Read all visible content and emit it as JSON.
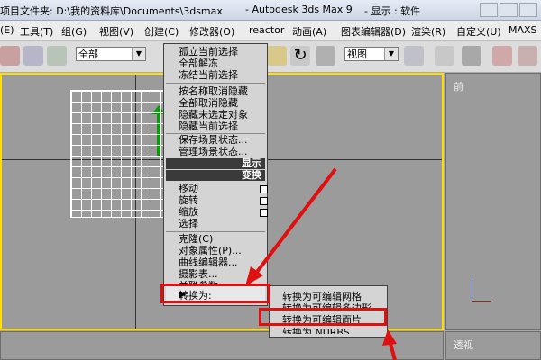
{
  "title": {
    "project": "项目文件夹: D:\\我的资料库\\Documents\\3dsmax",
    "app": "- Autodesk 3ds Max 9",
    "display": "- 显示 : 软件"
  },
  "menubar": {
    "items": [
      "(E)",
      "工具(T)",
      "组(G)",
      "视图(V)",
      "创建(C)",
      "修改器(O)",
      "reactor",
      "动画(A)",
      "图表编辑器(D)",
      "渲染(R)",
      "自定义(U)",
      "MAXS"
    ]
  },
  "toolbar": {
    "selection_filter": "全部",
    "view_dropdown": "视图"
  },
  "viewports": {
    "front_label": "前",
    "persp_label": "透视"
  },
  "context_menu": {
    "group1": [
      "孤立当前选择",
      "全部解冻",
      "冻结当前选择"
    ],
    "group2": [
      "按名称取消隐藏",
      "全部取消隐藏",
      "隐藏未选定对象",
      "隐藏当前选择"
    ],
    "group3": [
      "保存场景状态...",
      "管理场景状态..."
    ],
    "quad_display": "显示",
    "quad_transform": "变换",
    "transform_items": [
      "移动",
      "旋转",
      "缩放",
      "选择"
    ],
    "group5": [
      "克隆(C)",
      "对象属性(P)...",
      "曲线编辑器...",
      "摄影表...",
      "关联参数..."
    ],
    "convert_to": "转换为:"
  },
  "submenu": {
    "items": [
      "转换为可编辑网格",
      "转换为可编辑多边形",
      "转换为可编辑面片",
      "转换为 NURBS"
    ]
  },
  "colors": {
    "highlight_red": "#e01010",
    "active_viewport_border": "#ffde00",
    "quad_header": "#3a3a3a"
  }
}
